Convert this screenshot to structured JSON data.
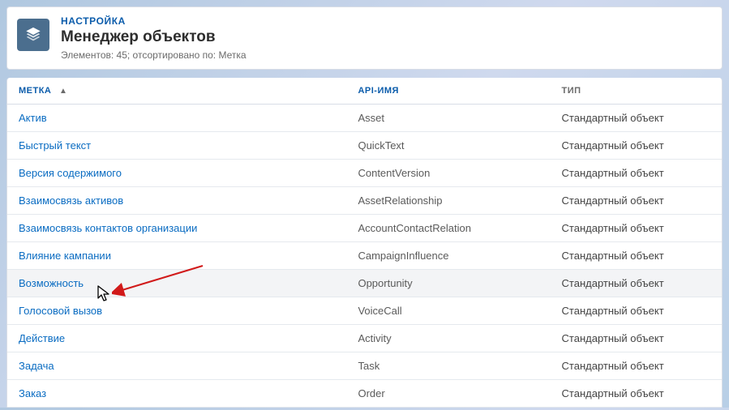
{
  "header": {
    "eyebrow": "НАСТРОЙКА",
    "title": "Менеджер объектов",
    "subtitle": "Элементов: 45; отсортировано по: Метка",
    "icon": "layers-icon"
  },
  "columns": {
    "label": "МЕТКА",
    "api": "API-ИМЯ",
    "type": "ТИП",
    "sort_indicator": "▲"
  },
  "rows": [
    {
      "label": "Актив",
      "api": "Asset",
      "type": "Стандартный объект",
      "highlight": false
    },
    {
      "label": "Быстрый текст",
      "api": "QuickText",
      "type": "Стандартный объект",
      "highlight": false
    },
    {
      "label": "Версия содержимого",
      "api": "ContentVersion",
      "type": "Стандартный объект",
      "highlight": false
    },
    {
      "label": "Взаимосвязь активов",
      "api": "AssetRelationship",
      "type": "Стандартный объект",
      "highlight": false
    },
    {
      "label": "Взаимосвязь контактов организации",
      "api": "AccountContactRelation",
      "type": "Стандартный объект",
      "highlight": false
    },
    {
      "label": "Влияние кампании",
      "api": "CampaignInfluence",
      "type": "Стандартный объект",
      "highlight": false
    },
    {
      "label": "Возможность",
      "api": "Opportunity",
      "type": "Стандартный объект",
      "highlight": true
    },
    {
      "label": "Голосовой вызов",
      "api": "VoiceCall",
      "type": "Стандартный объект",
      "highlight": false
    },
    {
      "label": "Действие",
      "api": "Activity",
      "type": "Стандартный объект",
      "highlight": false
    },
    {
      "label": "Задача",
      "api": "Task",
      "type": "Стандартный объект",
      "highlight": false
    },
    {
      "label": "Заказ",
      "api": "Order",
      "type": "Стандартный объект",
      "highlight": false
    }
  ]
}
